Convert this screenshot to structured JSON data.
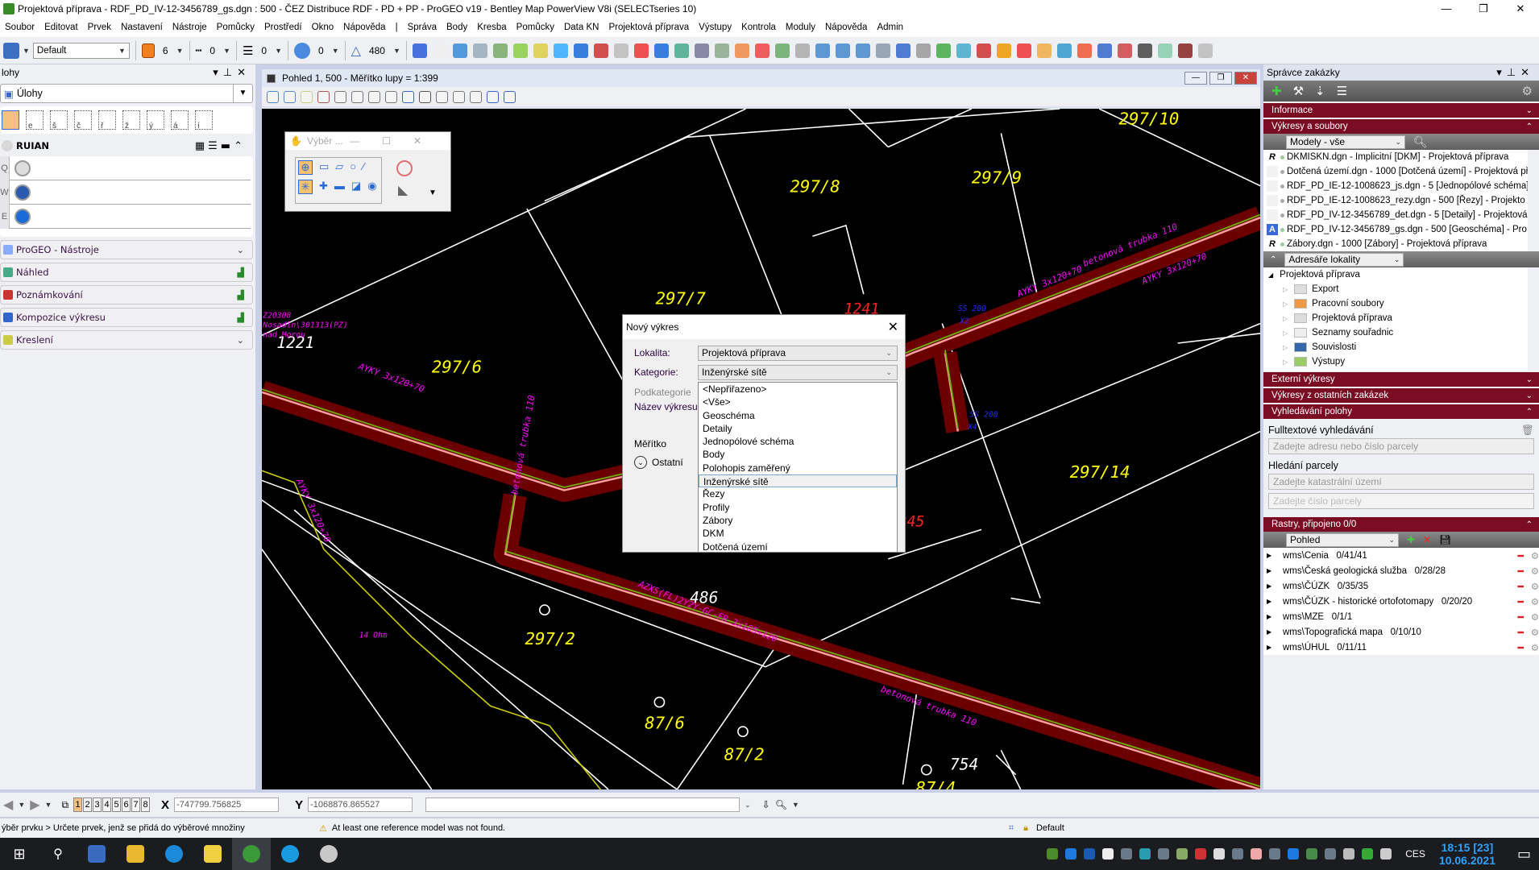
{
  "window": {
    "title": "Projektová příprava - RDF_PD_IV-12-3456789_gs.dgn : 500 - ČEZ Distribuce RDF - PD + PP - ProGEO v19 - Bentley Map PowerView V8i (SELECTseries 10)"
  },
  "menu": [
    "Soubor",
    "Editovat",
    "Prvek",
    "Nastavení",
    "Nástroje",
    "Pomůcky",
    "Prostředí",
    "Okno",
    "Nápověda",
    "|",
    "Správa",
    "Body",
    "Kresba",
    "Pomůcky",
    "Data KN",
    "Projektová příprava",
    "Výstupy",
    "Kontrola",
    "Moduly",
    "Nápověda",
    "Admin"
  ],
  "toolbar": {
    "level": "Default",
    "color": "6",
    "style": "0",
    "weight": "0",
    "transparency": "0",
    "priority": "480",
    "color_hex": "#f08020"
  },
  "left_panel": {
    "header": "lohy",
    "dropdown": "Úlohy",
    "tool_keys": [
      "",
      "e",
      "š",
      "č",
      "ř",
      "ž",
      "ý",
      "á",
      "í"
    ],
    "ruian": {
      "title": "RUIAN",
      "rows": [
        "Q",
        "W",
        "E"
      ]
    },
    "sections": [
      {
        "label": "ProGEO - Nástroje",
        "right": "⌄",
        "icon": "wand-icon"
      },
      {
        "label": "Náhled",
        "right": "▟",
        "icon": "preview-icon"
      },
      {
        "label": "Poznámkování",
        "right": "▟",
        "icon": "markup-icon"
      },
      {
        "label": "Kompozice výkresu",
        "right": "▟",
        "icon": "sheet-icon"
      },
      {
        "label": "Kreslení",
        "right": "⌄",
        "icon": "drawing-icon"
      }
    ]
  },
  "view": {
    "title": "Pohled 1, 500 - Měřítko lupy = 1:399",
    "map": {
      "parcel_labels": [
        "297/10",
        "297/8",
        "297/9",
        "297/7",
        "297/6",
        "297/14",
        "297/2",
        "87/6",
        "87/2",
        "87/4"
      ],
      "white_labels": [
        "1221",
        "486",
        "754"
      ],
      "red_labels": [
        "1241",
        "245"
      ],
      "cable_labels": [
        "AYKY 3x120+70",
        "AYKY 3x120+70",
        "AYKY 3x120+70",
        "AYKY 3x120+70",
        "betonová trubka 110",
        "betonová trubka 110",
        "betonová trubka 110",
        "AZXS(FL)2Y2Y-GC-FR 3x185+120",
        "14 Ohm",
        "Z20308",
        "Nosadln\\301313(PZ)",
        "nad Morou"
      ],
      "blue_labels": [
        "SS 200",
        "X2",
        "SS 200",
        "X4"
      ],
      "colors": {
        "parcel": "#ffff00",
        "cable": "#ff00ff",
        "corridor": "#6a0000",
        "boundary": "#ffffff"
      }
    }
  },
  "vyber": {
    "title": "Výběr ..."
  },
  "dialog": {
    "title": "Nový výkres",
    "lokalita_label": "Lokalita:",
    "lokalita_value": "Projektová příprava",
    "kategorie_label": "Kategorie:",
    "kategorie_value": "Inženýrské sítě",
    "podkategorie_label": "Podkategorie",
    "nazev_label": "Název výkresu:",
    "meritko_label": "Měřítko",
    "ostatni_label": "Ostatní",
    "options": [
      "<Nepřiřazeno>",
      "<Vše>",
      "Geoschéma",
      "Detaily",
      "Jednopólové schéma",
      "Body",
      "Polohopis zaměřený",
      "Inženýrské sítě",
      "Řezy",
      "Profily",
      "Zábory",
      "DKM",
      "Dotčená území"
    ],
    "selected_index": 7
  },
  "right_panel": {
    "title": "Správce zakázky",
    "informace": "Informace",
    "vykresy": "Výkresy a soubory",
    "models_filter": "Modely - vše",
    "files": [
      {
        "badge": "R",
        "name": "DKMISKN.dgn - Implicitní [DKM]  - Projektová příprava"
      },
      {
        "badge": "",
        "name": "Dotčená území.dgn - 1000 [Dotčená území]  - Projektová pří"
      },
      {
        "badge": "",
        "name": "RDF_PD_IE-12-1008623_js.dgn - 5 [Jednopólové schéma]"
      },
      {
        "badge": "",
        "name": "RDF_PD_IE-12-1008623_rezy.dgn - 500 [Řezy]  - Projekto"
      },
      {
        "badge": "",
        "name": "RDF_PD_IV-12-3456789_det.dgn - 5 [Detaily]  - Projektová"
      },
      {
        "badge": "A",
        "name": "RDF_PD_IV-12-3456789_gs.dgn - 500 [Geoschéma]  - Pro"
      },
      {
        "badge": "R",
        "name": "Zábory.dgn - 1000 [Zábory]  - Projektová příprava"
      }
    ],
    "folders_filter": "Adresáře lokality",
    "tree_root": "Projektová příprava",
    "tree": [
      "Export",
      "Pracovní soubory",
      "Projektová příprava",
      "Seznamy souřadnic",
      "Souvislosti",
      "Výstupy"
    ],
    "externi": "Externí výkresy",
    "ostatni": "Výkresy z ostatních zakázek",
    "vyhledavani": "Vyhledávání polohy",
    "fulltext_label": "Fulltextové vyhledávání",
    "fulltext_placeholder": "Zadejte adresu nebo číslo parcely",
    "parcel_label": "Hledání parcely",
    "ku_placeholder": "Zadejte katastrální území",
    "parcel_placeholder": "Zadejte číslo parcely",
    "rastry": "Rastry, připojeno 0/0",
    "raster_view": "Pohled",
    "rasters": [
      "wms\\Cenia   0/41/41",
      "wms\\Česká geologická služba   0/28/28",
      "wms\\ČÚZK   0/35/35",
      "wms\\ČÚZK - historické ortofotomapy   0/20/20",
      "wms\\MZE   0/1/1",
      "wms\\Topografická mapa   0/10/10",
      "wms\\ÚHUL   0/11/11"
    ],
    "band_color": "#7a0c24"
  },
  "bottom": {
    "views": [
      "1",
      "2",
      "3",
      "4",
      "5",
      "6",
      "7",
      "8"
    ],
    "x_label": "X",
    "x_value": "-747799.756825",
    "y_label": "Y",
    "y_value": "-1068876.865527"
  },
  "status": {
    "prompt": "ýběr prvku > Určete prvek, jenž se přidá do výběrové množiny",
    "message": "At least one reference model was not found.",
    "level": "Default"
  },
  "taskbar": {
    "time": "18:15  [23]",
    "date": "10.06.2021",
    "lang": "CES"
  }
}
